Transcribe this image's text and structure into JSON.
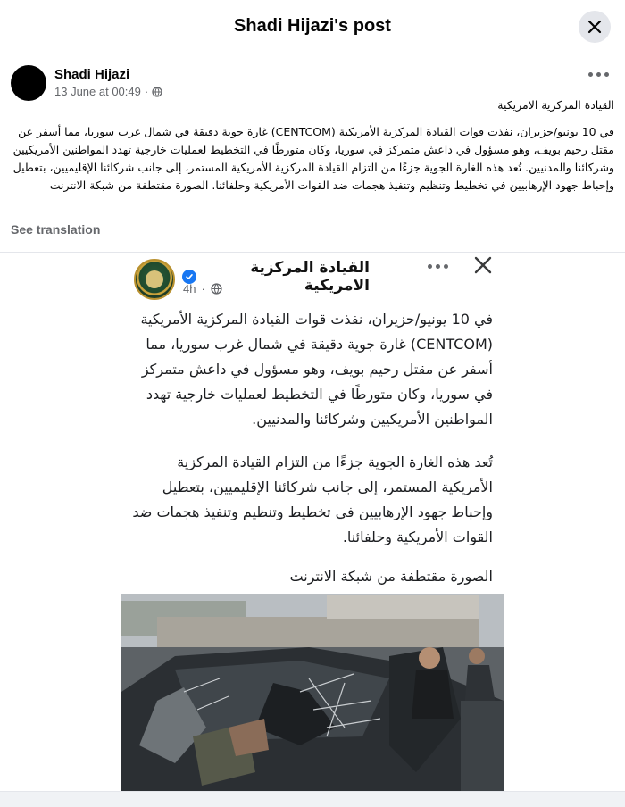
{
  "dialog": {
    "title": "Shadi Hijazi's post",
    "close_icon": "close-icon"
  },
  "post": {
    "author": "Shadi Hijazi",
    "date": "13 June at 00:49",
    "separator": "·",
    "audience_icon": "globe-icon",
    "text_line1": "القيادة المركزية الامريكية",
    "text_body": "في 10 يونيو/حزيران، نفذت قوات القيادة المركزية الأمريكية (CENTCOM) غارة جوية دقيقة في شمال غرب سوريا، مما أسفر عن مقتل رحيم بويف، وهو مسؤول في داعش متمركز في سوريا، وكان متورطًا في التخطيط لعمليات خارجية تهدد المواطنين الأمريكيين وشركائنا والمدنيين. تُعد هذه الغارة الجوية جزءًا من التزام القيادة المركزية الأمريكية المستمر، إلى جانب شركائنا الإقليميين، بتعطيل وإحباط جهود الإرهابيين في تخطيط وتنظيم وتنفيذ هجمات ضد القوات الأمريكية وحلفائنا. الصورة مقتطفة من شبكة الانترنت",
    "see_translation": "See translation",
    "more_icon": "more-dots-icon"
  },
  "shared_post": {
    "page_name": "القيادة المركزية الامريكية",
    "verified_icon": "verified-badge-icon",
    "time": "4h",
    "separator": "·",
    "audience_icon": "globe-icon",
    "logo": "centcom-seal-logo",
    "paragraph1": "في 10 يونيو/حزيران، نفذت قوات القيادة المركزية الأمريكية (CENTCOM) غارة جوية دقيقة في شمال غرب سوريا، مما أسفر عن مقتل رحيم بويف، وهو مسؤول في داعش متمركز في سوريا، وكان متورطًا في التخطيط لعمليات خارجية تهدد المواطنين الأمريكيين وشركائنا والمدنيين.",
    "paragraph2": "تُعد هذه الغارة الجوية جزءًا من التزام القيادة المركزية الأمريكية المستمر، إلى جانب شركائنا الإقليميين، بتعطيل وإحباط جهود الإرهابيين في تخطيط وتنظيم وتنفيذ هجمات ضد القوات الأمريكية وحلفائنا.",
    "paragraph3": "الصورة مقتطفة من شبكة الانترنت",
    "more_icon": "more-dots-icon",
    "close_icon": "close-icon"
  },
  "colors": {
    "verified_blue": "#1877f2",
    "secondary_text": "#65676b",
    "close_bg": "#e4e6eb"
  }
}
